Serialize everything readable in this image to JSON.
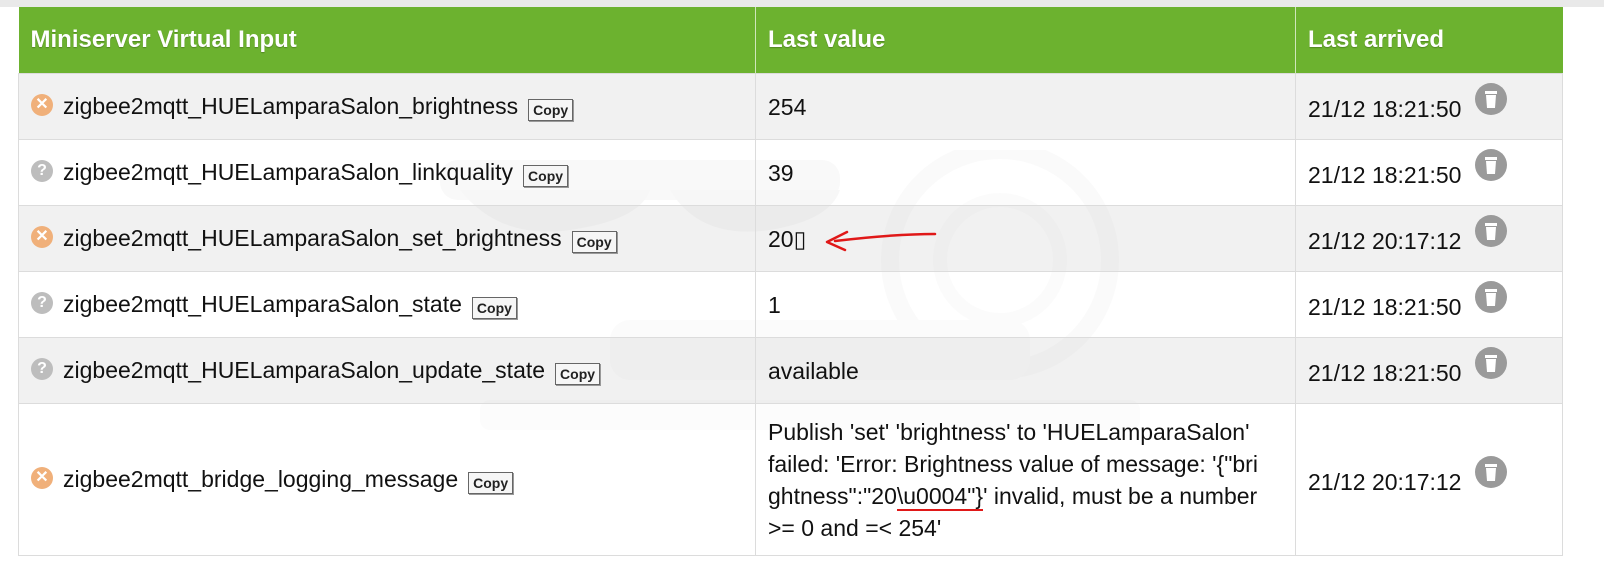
{
  "table": {
    "headers": [
      "Miniserver Virtual Input",
      "Last value",
      "Last arrived"
    ],
    "copy_label": "Copy",
    "rows": [
      {
        "status": "error",
        "name": "zigbee2mqtt_HUELamparaSalon_brightness",
        "value": "254",
        "arrived": "21/12 18:21:50"
      },
      {
        "status": "unknown",
        "name": "zigbee2mqtt_HUELamparaSalon_linkquality",
        "value": "39",
        "arrived": "21/12 18:21:50"
      },
      {
        "status": "error",
        "name": "zigbee2mqtt_HUELamparaSalon_set_brightness",
        "value": "20▯",
        "arrived": "21/12 20:17:12"
      },
      {
        "status": "unknown",
        "name": "zigbee2mqtt_HUELamparaSalon_state",
        "value": "1",
        "arrived": "21/12 18:21:50"
      },
      {
        "status": "unknown",
        "name": "zigbee2mqtt_HUELamparaSalon_update_state",
        "value": "available",
        "arrived": "21/12 18:21:50"
      },
      {
        "status": "error",
        "name": "zigbee2mqtt_bridge_logging_message",
        "value_lines": [
          "Publish 'set' 'brightness' to 'HUELamparaSalon'",
          "failed: 'Error: Brightness value of message: '{\"bri",
          "ghtness\":\"20\\u0004\"}' invalid, must be a number",
          ">= 0 and =< 254'"
        ],
        "arrived": "21/12 20:17:12"
      }
    ]
  },
  "colors": {
    "header_bg": "#6cb22f",
    "annotation_red": "#e01818",
    "status_error": "#f0b07a",
    "status_unknown": "#bdbdbd"
  },
  "icons": {
    "status_error": "x-circle-icon",
    "status_unknown": "question-circle-icon",
    "delete": "trash-icon"
  }
}
